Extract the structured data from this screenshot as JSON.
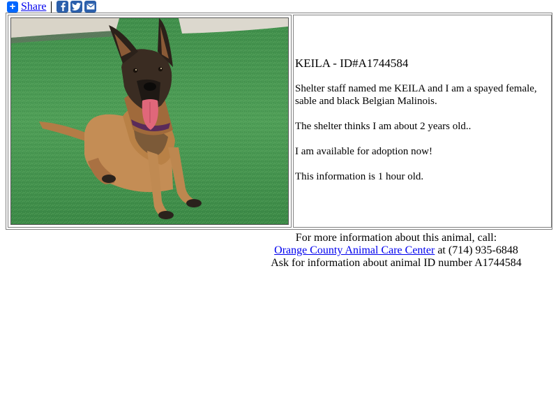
{
  "share": {
    "label": "Share",
    "plus_glyph": "+",
    "icons": [
      "plus-icon",
      "facebook-icon",
      "twitter-icon",
      "email-icon"
    ],
    "accent_color": "#0166ff",
    "social_color": "#2b5fab"
  },
  "animal": {
    "heading": "KEILA - ID#A1744584",
    "description": "Shelter staff named me KEILA and I am a spayed female, sable and black Belgian Malinois.",
    "age": "The shelter thinks I am about 2 years old..",
    "availability": "I am available for adoption now!",
    "freshness": "This information is 1 hour old."
  },
  "contact": {
    "intro": "For more information about this animal, call:",
    "shelter_name": "Orange County Animal Care Center",
    "phone_text": " at (714) 935-6848",
    "ask_text": "Ask for information about animal ID number A1744584"
  }
}
